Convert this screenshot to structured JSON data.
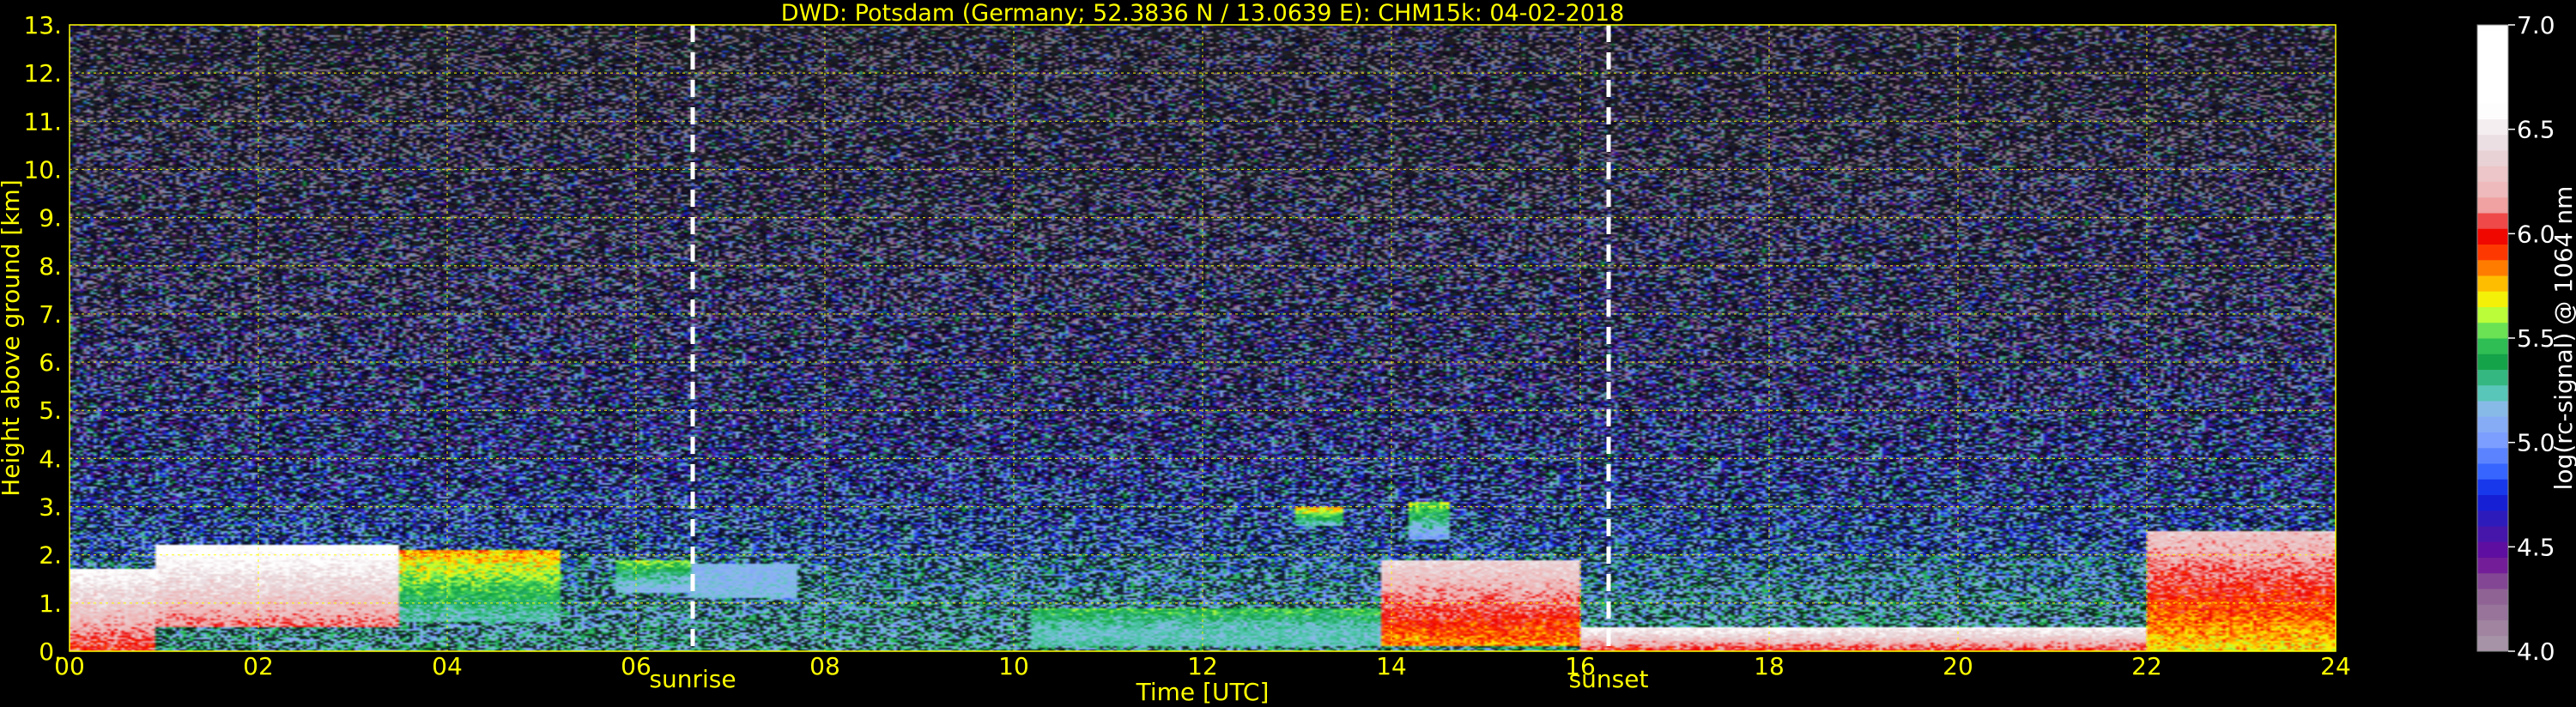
{
  "colors": {
    "background": "#000000",
    "text": "#ffff00",
    "grid": "#ffff00",
    "event_line": "#ffffff",
    "colorbar_text": "#ffffff"
  },
  "chart_data": {
    "type": "heatmap",
    "title": "DWD: Potsdam (Germany; 52.3836 N / 13.0639 E):    CHM15k: 04-02-2018",
    "xlabel": "Time [UTC]",
    "ylabel": "Height above ground [km]",
    "xlim": [
      0,
      24
    ],
    "ylim": [
      0,
      13
    ],
    "x_ticks": [
      {
        "value": 0,
        "label": "00"
      },
      {
        "value": 2,
        "label": "02"
      },
      {
        "value": 4,
        "label": "04"
      },
      {
        "value": 6,
        "label": "06"
      },
      {
        "value": 8,
        "label": "08"
      },
      {
        "value": 10,
        "label": "10"
      },
      {
        "value": 12,
        "label": "12"
      },
      {
        "value": 14,
        "label": "14"
      },
      {
        "value": 16,
        "label": "16"
      },
      {
        "value": 18,
        "label": "18"
      },
      {
        "value": 20,
        "label": "20"
      },
      {
        "value": 22,
        "label": "22"
      },
      {
        "value": 24,
        "label": "24"
      }
    ],
    "y_ticks": [
      {
        "value": 0,
        "label": "0."
      },
      {
        "value": 1,
        "label": "1."
      },
      {
        "value": 2,
        "label": "2."
      },
      {
        "value": 3,
        "label": "3."
      },
      {
        "value": 4,
        "label": "4."
      },
      {
        "value": 5,
        "label": "5."
      },
      {
        "value": 6,
        "label": "6."
      },
      {
        "value": 7,
        "label": "7."
      },
      {
        "value": 8,
        "label": "8."
      },
      {
        "value": 9,
        "label": "9."
      },
      {
        "value": 10,
        "label": "10."
      },
      {
        "value": 11,
        "label": "11."
      },
      {
        "value": 12,
        "label": "12."
      },
      {
        "value": 13,
        "label": "13."
      }
    ],
    "grid": true,
    "grid_style": "dotted",
    "events": [
      {
        "name": "sunrise",
        "time": 6.6
      },
      {
        "name": "sunset",
        "time": 16.3
      }
    ],
    "colorbar": {
      "label": "log(rc-signal) @ 1064 nm",
      "range": [
        4.0,
        7.0
      ],
      "ticks": [
        {
          "value": 4.0,
          "label": "4.0"
        },
        {
          "value": 4.5,
          "label": "4.5"
        },
        {
          "value": 5.0,
          "label": "5.0"
        },
        {
          "value": 5.5,
          "label": "5.5"
        },
        {
          "value": 6.0,
          "label": "6.0"
        },
        {
          "value": 6.5,
          "label": "6.5"
        },
        {
          "value": 7.0,
          "label": "7.0"
        }
      ],
      "stops": [
        {
          "value": 4.0,
          "color": "#ab9bab"
        },
        {
          "value": 4.15,
          "color": "#9c7c9c"
        },
        {
          "value": 4.3,
          "color": "#8c5a92"
        },
        {
          "value": 4.45,
          "color": "#6a0a9a"
        },
        {
          "value": 4.6,
          "color": "#3a1ab0"
        },
        {
          "value": 4.75,
          "color": "#0a20e0"
        },
        {
          "value": 4.85,
          "color": "#3060ff"
        },
        {
          "value": 5.0,
          "color": "#7a9cff"
        },
        {
          "value": 5.15,
          "color": "#90b8f0"
        },
        {
          "value": 5.25,
          "color": "#50c8b0"
        },
        {
          "value": 5.4,
          "color": "#10a040"
        },
        {
          "value": 5.5,
          "color": "#40d060"
        },
        {
          "value": 5.6,
          "color": "#b0ff40"
        },
        {
          "value": 5.7,
          "color": "#ffee00"
        },
        {
          "value": 5.8,
          "color": "#ffa000"
        },
        {
          "value": 5.9,
          "color": "#ff4000"
        },
        {
          "value": 6.0,
          "color": "#ee0000"
        },
        {
          "value": 6.15,
          "color": "#f0b0b0"
        },
        {
          "value": 6.4,
          "color": "#e8d8dc"
        },
        {
          "value": 6.6,
          "color": "#ffffff"
        },
        {
          "value": 7.0,
          "color": "#ffffff"
        }
      ]
    },
    "field": {
      "description_free": true,
      "cloud_regions": [
        {
          "t0": 0.0,
          "t1": 0.9,
          "h0": 0.0,
          "h1": 1.7,
          "value": 6.6
        },
        {
          "t0": 0.9,
          "t1": 3.5,
          "h0": 0.5,
          "h1": 2.2,
          "value": 6.7
        },
        {
          "t0": 3.5,
          "t1": 5.2,
          "h0": 0.6,
          "h1": 2.1,
          "value": 5.8
        },
        {
          "t0": 5.8,
          "t1": 6.6,
          "h0": 1.2,
          "h1": 1.9,
          "value": 5.6
        },
        {
          "t0": 6.6,
          "t1": 7.7,
          "h0": 1.1,
          "h1": 1.8,
          "value": 5.1
        },
        {
          "t0": 10.2,
          "t1": 13.9,
          "h0": 0.1,
          "h1": 0.9,
          "value": 5.5
        },
        {
          "t0": 13.0,
          "t1": 13.5,
          "h0": 2.6,
          "h1": 3.0,
          "value": 5.8
        },
        {
          "t0": 14.2,
          "t1": 14.6,
          "h0": 2.3,
          "h1": 3.1,
          "value": 5.6
        },
        {
          "t0": 13.9,
          "t1": 16.0,
          "h0": 0.1,
          "h1": 1.9,
          "value": 6.4
        },
        {
          "t0": 16.0,
          "t1": 22.0,
          "h0": 0.0,
          "h1": 0.5,
          "value": 6.6
        },
        {
          "t0": 22.0,
          "t1": 24.0,
          "h0": 0.0,
          "h1": 2.5,
          "value": 6.3
        }
      ]
    }
  }
}
